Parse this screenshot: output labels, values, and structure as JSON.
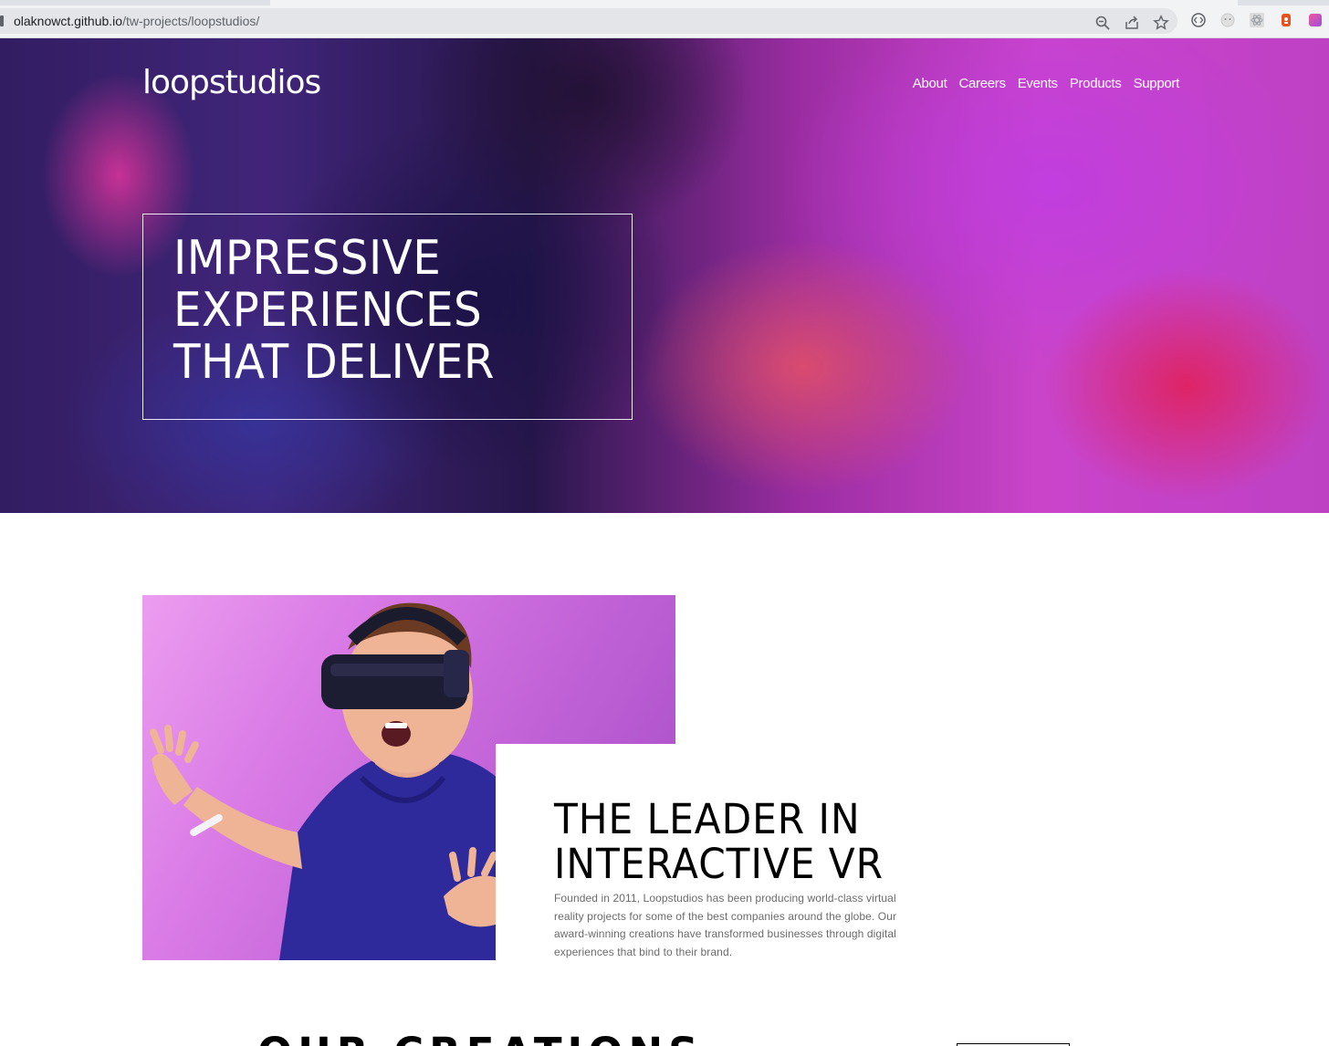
{
  "browser": {
    "url_host": "olaknowct.github.io",
    "url_path": "/tw-projects/loopstudios/"
  },
  "header": {
    "logo": "loopstudios",
    "nav": [
      "About",
      "Careers",
      "Events",
      "Products",
      "Support"
    ]
  },
  "hero": {
    "title_lines": [
      "IMPRESSIVE",
      "EXPERIENCES",
      "THAT DELIVER"
    ]
  },
  "interactive": {
    "title_lines": [
      "THE LEADER IN",
      "INTERACTIVE VR"
    ],
    "text": "Founded in 2011, Loopstudios has been producing world-class virtual reality projects for some of the best companies around the globe. Our award-winning creations have transformed businesses through digital experiences that bind to their brand."
  },
  "creations": {
    "title": "OUR CREATIONS"
  },
  "colors": {
    "accent_pink": "#e64ee6",
    "text_dark": "#000000",
    "text_muted": "#6b6b6b"
  }
}
